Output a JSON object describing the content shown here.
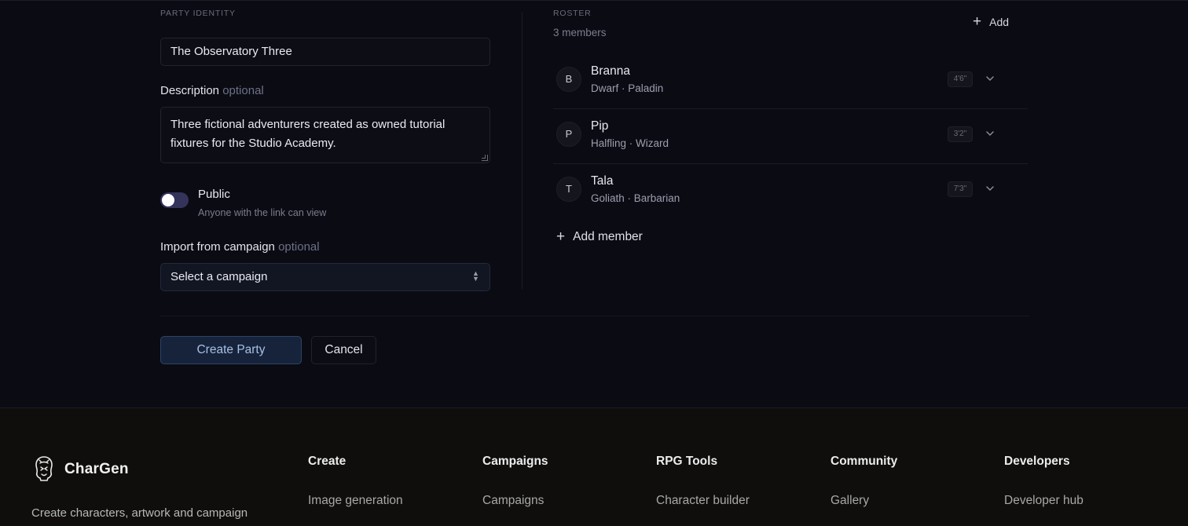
{
  "form": {
    "identity_label": "PARTY IDENTITY",
    "party_name": "The Observatory Three",
    "description_label": "Description",
    "description_optional": "optional",
    "description_value": "Three fictional adventurers created as owned tutorial fixtures for the Studio Academy.",
    "public_label": "Public",
    "public_hint": "Anyone with the link can view",
    "public_enabled": false,
    "import_label": "Import from campaign",
    "import_optional": "optional",
    "import_selected": "Select a campaign"
  },
  "roster": {
    "label": "ROSTER",
    "count": "3 members",
    "add_label": "Add",
    "add_member_label": "Add member",
    "members": [
      {
        "initial": "B",
        "name": "Branna",
        "detail": "Dwarf · Paladin",
        "height": "4'6\""
      },
      {
        "initial": "P",
        "name": "Pip",
        "detail": "Halfling · Wizard",
        "height": "3'2\""
      },
      {
        "initial": "T",
        "name": "Tala",
        "detail": "Goliath · Barbarian",
        "height": "7'3\""
      }
    ]
  },
  "actions": {
    "create_label": "Create Party",
    "cancel_label": "Cancel"
  },
  "footer": {
    "brand": "CharGen",
    "tagline": "Create characters, artwork and campaign",
    "columns": [
      {
        "heading": "Create",
        "first_link": "Image generation"
      },
      {
        "heading": "Campaigns",
        "first_link": "Campaigns"
      },
      {
        "heading": "RPG Tools",
        "first_link": "Character builder"
      },
      {
        "heading": "Community",
        "first_link": "Gallery"
      },
      {
        "heading": "Developers",
        "first_link": "Developer hub"
      }
    ]
  },
  "colors": {
    "background": "#0b0b14",
    "footer_background": "#0f0e0d",
    "primary_button": "#16233a",
    "primary_text": "#a7c0e6",
    "toggle_track": "#34335a"
  }
}
